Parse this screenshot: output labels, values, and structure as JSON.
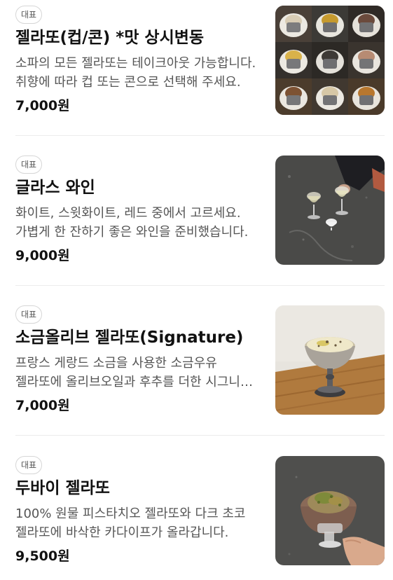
{
  "menu": {
    "items": [
      {
        "badge": "대표",
        "name": "젤라또(컵/콘) *맛 상시변동",
        "description": "소파의 모든 젤라또는 테이크아웃 가능합니다. 취향에 따라 컵 또는 콘으로 선택해 주세요.",
        "price": "7,000원",
        "image_icon": "gelato-grid-photo"
      },
      {
        "badge": "대표",
        "name": "글라스 와인",
        "description": "화이트, 스윗화이트, 레드 중에서 고르세요. 가볍게 한 잔하기 좋은 와인을 준비했습니다.",
        "price": "9,000원",
        "image_icon": "wine-glass-photo"
      },
      {
        "badge": "대표",
        "name": "소금올리브 젤라또(Signature)",
        "description": "프랑스 게랑드 소금을 사용한 소금우유 젤라또에 올리브오일과 후추를 더한 시그니처 메뉴입니다.",
        "price": "7,000원",
        "image_icon": "coupe-gelato-photo"
      },
      {
        "badge": "대표",
        "name": "두바이 젤라또",
        "description": "100% 원물 피스타치오 젤라또와 다크 초코 젤라또에 바삭한 카다이프가 올라갑니다.",
        "price": "9,500원",
        "image_icon": "pistachio-gelato-photo"
      }
    ]
  }
}
